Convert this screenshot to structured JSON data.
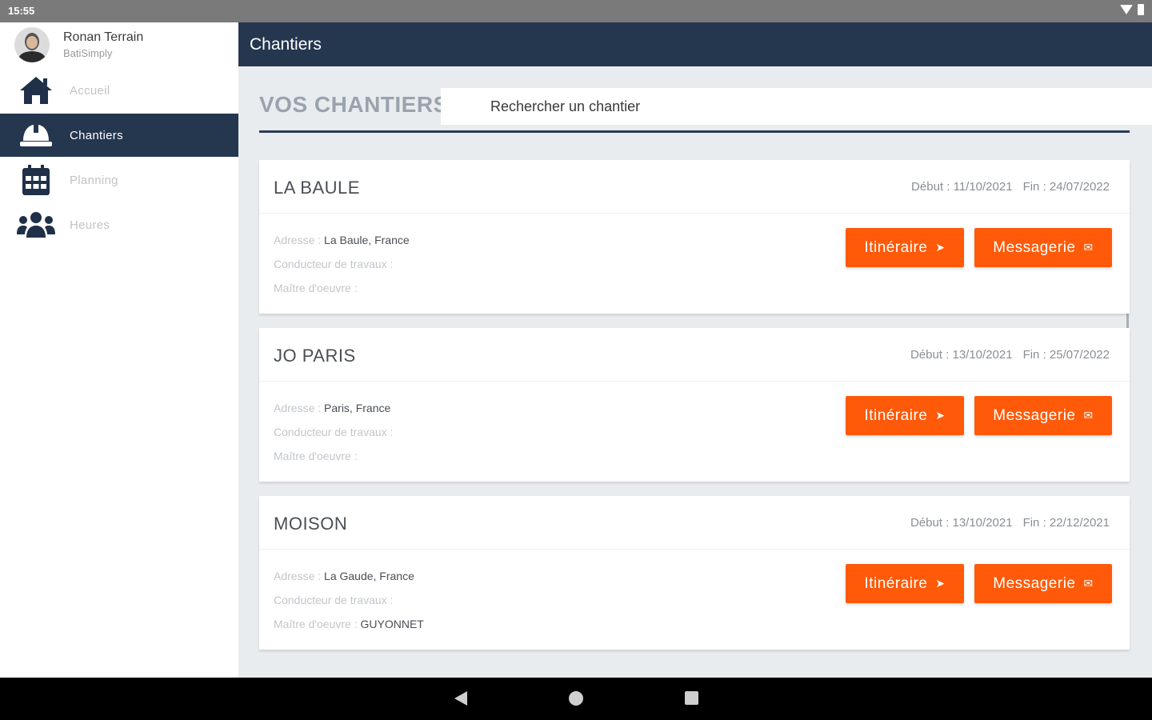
{
  "status_bar": {
    "time": "15:55"
  },
  "user": {
    "name": "Ronan Terrain",
    "company": "BatiSimply"
  },
  "nav": [
    {
      "label": "Accueil",
      "icon": "home-icon"
    },
    {
      "label": "Chantiers",
      "icon": "hard-hat-icon",
      "active": true
    },
    {
      "label": "Planning",
      "icon": "calendar-icon"
    },
    {
      "label": "Heures",
      "icon": "users-icon"
    }
  ],
  "header": {
    "title": "Chantiers"
  },
  "main": {
    "section_title": "VOS CHANTIERS",
    "search_placeholder": "Rechercher un chantier"
  },
  "labels": {
    "address": "Adresse :",
    "conductor": "Conducteur de travaux :",
    "architect": "Maître d'oeuvre :",
    "start": "Début :",
    "end": "Fin :",
    "itinerary_button": "Itinéraire",
    "messaging_button": "Messagerie"
  },
  "sites": [
    {
      "name": "LA BAULE",
      "start": "11/10/2021",
      "end": "24/07/2022",
      "address": "La Baule, France",
      "conductor": "",
      "architect": ""
    },
    {
      "name": "JO PARIS",
      "start": "13/10/2021",
      "end": "25/07/2022",
      "address": "Paris, France",
      "conductor": "",
      "architect": ""
    },
    {
      "name": "MOISON",
      "start": "13/10/2021",
      "end": "22/12/2021",
      "address": "La Gaude, France",
      "conductor": "",
      "architect": "GUYONNET"
    }
  ],
  "colors": {
    "primary": "#25364f",
    "accent": "#ff5a0a",
    "background": "#e9ecef"
  }
}
